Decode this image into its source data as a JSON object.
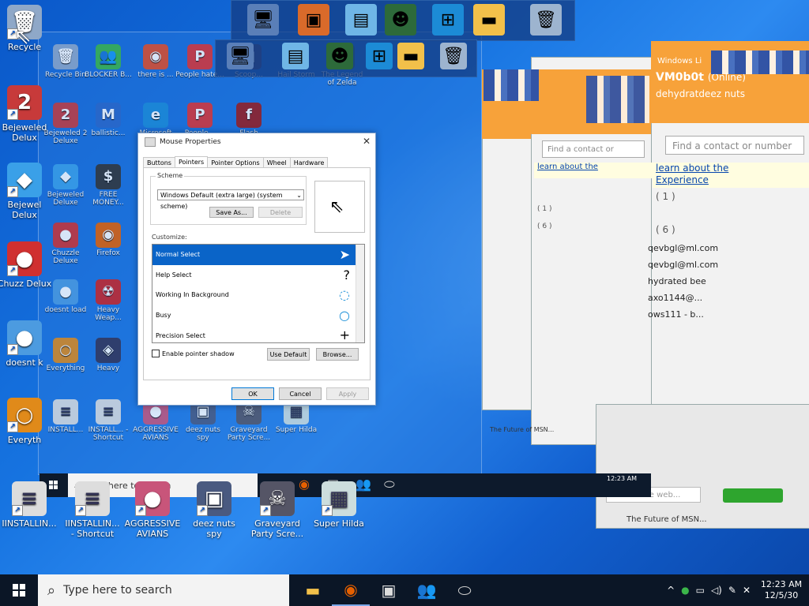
{
  "desktop": {
    "icons": [
      {
        "label": "Recycle",
        "glyph": "🗑",
        "bg": "#8fa8c8"
      },
      {
        "label": "Bejeweled Delux",
        "glyph": "2",
        "bg": "#c73a3a"
      },
      {
        "label": "Bejewel Delux",
        "glyph": "◆",
        "bg": "#3aa0e8"
      },
      {
        "label": "Chuzz Delux",
        "glyph": "●",
        "bg": "#d03030"
      },
      {
        "label": "doesnt k",
        "glyph": "●",
        "bg": "#4c9be0"
      },
      {
        "label": "Everyth",
        "glyph": "○",
        "bg": "#e08a1a"
      }
    ],
    "bottom_icons": [
      {
        "label": "IINSTALLIN...",
        "glyph": "≡",
        "bg": "#ddd"
      },
      {
        "label": "IINSTALLIN... - Shortcut",
        "glyph": "≡",
        "bg": "#ddd"
      },
      {
        "label": "AGGRESSIVE AVIANS",
        "glyph": "●",
        "bg": "#c8557a"
      },
      {
        "label": "deez nuts spy",
        "glyph": "▣",
        "bg": "#4a5a80"
      },
      {
        "label": "Graveyard Party Scre...",
        "glyph": "☠",
        "bg": "#556"
      },
      {
        "label": "Super Hilda",
        "glyph": "▦",
        "bg": "#cdd"
      }
    ]
  },
  "ghost_icons": [
    {
      "label": "Recycle Bin",
      "glyph": "🗑",
      "bg": "#8fa8c8"
    },
    {
      "label": "BLOCKER B...",
      "glyph": "👥",
      "bg": "#3bb54a"
    },
    {
      "label": "there is ...",
      "glyph": "◉",
      "bg": "#e34c26"
    },
    {
      "label": "People hate...",
      "glyph": "P",
      "bg": "#d33"
    },
    {
      "label": "Scoop...",
      "glyph": "▦",
      "bg": "#447"
    },
    {
      "label": "Hail Storm",
      "glyph": "▤",
      "bg": "#557"
    },
    {
      "label": "The Legend of Zelda",
      "glyph": "◎",
      "bg": "#365"
    },
    {
      "label": "Bejeweled 2 Deluxe",
      "glyph": "2",
      "bg": "#c73a3a"
    },
    {
      "label": "ballistic...",
      "glyph": "M",
      "bg": "#2a66c8"
    },
    {
      "label": "Microsoft Edge",
      "glyph": "e",
      "bg": "#1c8bd6"
    },
    {
      "label": "People...",
      "glyph": "P",
      "bg": "#d33"
    },
    {
      "label": "Flash",
      "glyph": "f",
      "bg": "#9a1a1a"
    },
    {
      "label": "Bejeweled Deluxe",
      "glyph": "◆",
      "bg": "#3aa0e8"
    },
    {
      "label": "FREE MONEY...",
      "glyph": "$",
      "bg": "#333"
    },
    {
      "label": "Chuzzle Deluxe",
      "glyph": "●",
      "bg": "#d03030"
    },
    {
      "label": "Firefox",
      "glyph": "◉",
      "bg": "#e66000"
    },
    {
      "label": "doesnt load",
      "glyph": "●",
      "bg": "#4c9be0"
    },
    {
      "label": "Heavy Weap...",
      "glyph": "☢",
      "bg": "#c22"
    },
    {
      "label": "Everything",
      "glyph": "○",
      "bg": "#e08a1a"
    },
    {
      "label": "Heavy",
      "glyph": "◈",
      "bg": "#335"
    },
    {
      "label": "INSTALL...",
      "glyph": "≡",
      "bg": "#ddd"
    },
    {
      "label": "INSTALL... - Shortcut",
      "glyph": "≡",
      "bg": "#ddd"
    },
    {
      "label": "AGGRESSIVE AVIANS",
      "glyph": "●",
      "bg": "#c8557a"
    },
    {
      "label": "deez nuts spy",
      "glyph": "▣",
      "bg": "#4a5a80"
    },
    {
      "label": "Graveyard Party Scre...",
      "glyph": "☠",
      "bg": "#556"
    },
    {
      "label": "Super Hilda",
      "glyph": "▦",
      "bg": "#cdd"
    }
  ],
  "mouse_properties": {
    "title": "Mouse Properties",
    "tabs": [
      "Buttons",
      "Pointers",
      "Pointer Options",
      "Wheel",
      "Hardware"
    ],
    "active_tab": "Pointers",
    "scheme_label": "Scheme",
    "scheme_value": "Windows Default (extra large) (system scheme)",
    "save_as": "Save As...",
    "delete": "Delete",
    "customize_label": "Customize:",
    "pointers": [
      {
        "name": "Normal Select",
        "glyph": "➤"
      },
      {
        "name": "Help Select",
        "glyph": "?"
      },
      {
        "name": "Working In Background",
        "glyph": "◌"
      },
      {
        "name": "Busy",
        "glyph": "○"
      },
      {
        "name": "Precision Select",
        "glyph": "+"
      }
    ],
    "shadow_label": "Enable pointer shadow",
    "use_default": "Use Default",
    "browse": "Browse...",
    "ok": "OK",
    "cancel": "Cancel",
    "apply": "Apply"
  },
  "messenger": {
    "title_partial": "Windows Li",
    "user": "VM0b0t",
    "status": "(Online)",
    "nick": "dehydratdeez nuts",
    "search_placeholder": "Find a contact or number",
    "ad_link": "learn about the",
    "ad_link2": "Experience",
    "group1": "( 1 )",
    "group2": "( 6 )",
    "contacts": [
      "qevbgl@ml.com",
      "qevbgl@ml.com",
      "hydrated bee",
      "axo1144@...",
      "ows111 - b..."
    ],
    "web_search_placeholder": "Search the web...",
    "footer": "The Future of MSN..."
  },
  "taskbar": {
    "search_placeholder": "Type here to search",
    "time": "12:23 AM",
    "date": "12/5/30"
  },
  "taskbar_ghost": {
    "search_placeholder": "Type here to search",
    "time": "12:23 AM"
  }
}
